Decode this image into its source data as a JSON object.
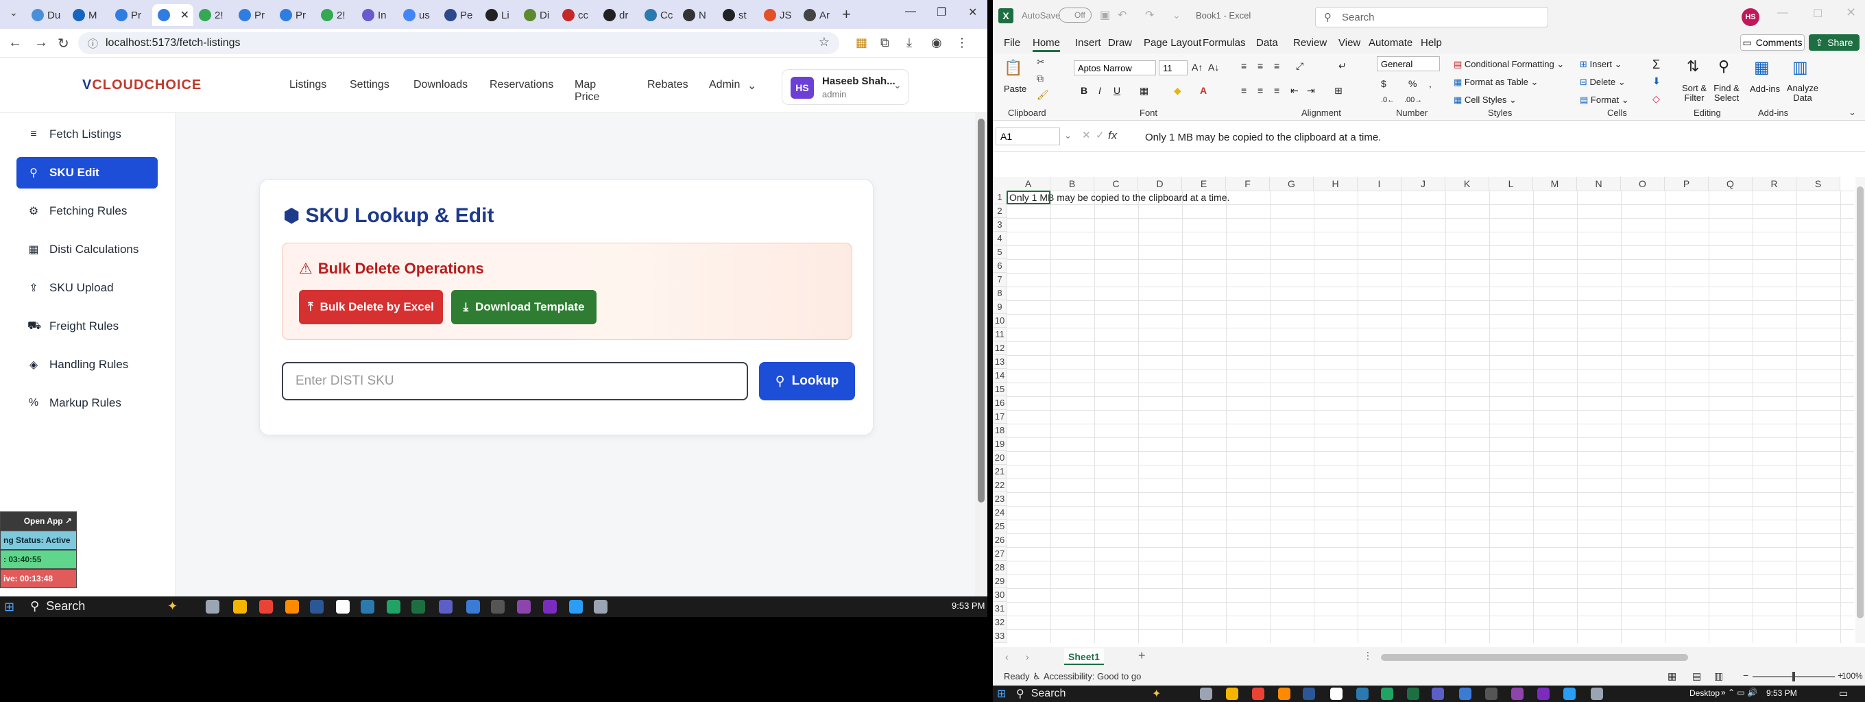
{
  "browser": {
    "tabs": [
      {
        "label": "Du",
        "color": "#4a90d9"
      },
      {
        "label": "M",
        "color": "#1565c0"
      },
      {
        "label": "Pr",
        "color": "#2f7de1"
      },
      {
        "label": "",
        "color": "#2f7de1"
      },
      {
        "label": "2!",
        "color": "#34a853"
      },
      {
        "label": "Pr",
        "color": "#2f7de1"
      },
      {
        "label": "Pr",
        "color": "#2f7de1"
      },
      {
        "label": "2!",
        "color": "#34a853"
      },
      {
        "label": "In",
        "color": "#6a5acd"
      },
      {
        "label": "us",
        "color": "#4285f4"
      },
      {
        "label": "Pe",
        "color": "#2b4a8b"
      },
      {
        "label": "Li",
        "color": "#222222"
      },
      {
        "label": "Di",
        "color": "#5c8a2e"
      },
      {
        "label": "cc",
        "color": "#c62828"
      },
      {
        "label": "dr",
        "color": "#222222"
      },
      {
        "label": "Cc",
        "color": "#2a7ab0"
      },
      {
        "label": "N",
        "color": "#333333"
      },
      {
        "label": "st",
        "color": "#222222"
      },
      {
        "label": "JS",
        "color": "#e34f26"
      },
      {
        "label": "Ar",
        "color": "#444444"
      }
    ],
    "url": "localhost:5173/fetch-listings",
    "clock": "9:53 PM",
    "search_label": "Search"
  },
  "app": {
    "logo_v": "V",
    "logo_text": "CLOUDCHOICE",
    "nav": [
      "Listings",
      "Settings",
      "Downloads",
      "Reservations",
      "Map Price",
      "Rebates",
      "Admin"
    ],
    "user": {
      "initials": "HS",
      "name": "Haseeb Shah...",
      "role": "admin"
    },
    "sidebar": [
      {
        "label": "Fetch Listings",
        "icon": "≡"
      },
      {
        "label": "SKU Edit",
        "icon": "⚲",
        "active": true
      },
      {
        "label": "Fetching Rules",
        "icon": "⚙"
      },
      {
        "label": "Disti Calculations",
        "icon": "▦"
      },
      {
        "label": "SKU Upload",
        "icon": "⇪"
      },
      {
        "label": "Freight Rules",
        "icon": "⛟"
      },
      {
        "label": "Handling Rules",
        "icon": "◈"
      },
      {
        "label": "Markup Rules",
        "icon": "%"
      }
    ],
    "card_title": "SKU Lookup & Edit",
    "bulk_title": "Bulk Delete Operations",
    "bulk_delete_label": "Bulk Delete by Excel",
    "download_template_label": "Download Template",
    "sku_placeholder": "Enter DISTI SKU",
    "lookup_label": "Lookup"
  },
  "widget": {
    "open_app": "Open App ↗",
    "status": "ng Status: Active",
    "timer1": ": 03:40:55",
    "timer2": "ive: 00:13:48"
  },
  "excel": {
    "autosave": "AutoSave",
    "autosave_state": "Off",
    "title": "Book1 - Excel",
    "search": "Search",
    "user_initials": "HS",
    "menus": [
      "File",
      "Home",
      "Insert",
      "Draw",
      "Page Layout",
      "Formulas",
      "Data",
      "Review",
      "View",
      "Automate",
      "Help"
    ],
    "comments": "Comments",
    "share": "Share",
    "font_name": "Aptos Narrow",
    "font_size": "11",
    "number_format": "General",
    "paste": "Paste",
    "conditional_formatting": "Conditional Formatting",
    "format_as_table": "Format as Table",
    "cell_styles": "Cell Styles",
    "insert": "Insert",
    "delete": "Delete",
    "format": "Format",
    "sort_filter": "Sort & Filter",
    "find_select": "Find & Select",
    "addins": "Add-ins",
    "analyze": "Analyze Data",
    "groups": [
      "Clipboard",
      "Font",
      "Alignment",
      "Number",
      "Styles",
      "Cells",
      "Editing",
      "Add-ins"
    ],
    "name_box": "A1",
    "formula": "Only 1 MB may be copied to the clipboard at a time.",
    "columns": [
      "A",
      "B",
      "C",
      "D",
      "E",
      "F",
      "G",
      "H",
      "I",
      "J",
      "K",
      "L",
      "M",
      "N",
      "O",
      "P",
      "Q",
      "R",
      "S"
    ],
    "rows": [
      "1",
      "2",
      "3",
      "4",
      "5",
      "6",
      "7",
      "8",
      "9",
      "10",
      "11",
      "12",
      "13",
      "14",
      "15",
      "16",
      "17",
      "18",
      "19",
      "20",
      "21",
      "22",
      "23",
      "24",
      "25",
      "26",
      "27",
      "28",
      "29",
      "30",
      "31",
      "32",
      "33"
    ],
    "a1_value": "Only 1 MB may be copied to the clipboard at a time.",
    "sheet": "Sheet1",
    "status_ready": "Ready",
    "accessibility": "Accessibility: Good to go",
    "zoom": "100%",
    "taskbar_search": "Search",
    "taskbar_desktop": "Desktop",
    "clock": "9:53 PM"
  }
}
